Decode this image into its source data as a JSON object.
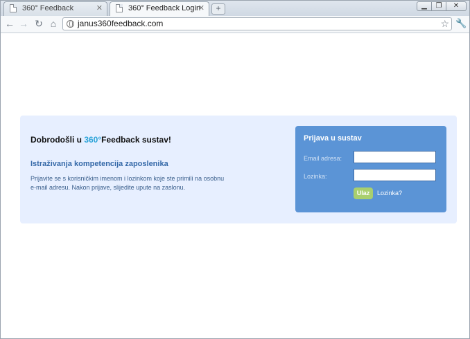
{
  "browser": {
    "tabs": [
      {
        "label": "360° Feedback",
        "active": false
      },
      {
        "label": "360° Feedback Login",
        "active": true
      }
    ],
    "new_tab_symbol": "+",
    "url": "janus360feedback.com",
    "icons": {
      "back": "back-arrow-icon",
      "forward": "forward-arrow-icon",
      "reload": "reload-icon",
      "home": "home-icon",
      "site": "globe-icon",
      "bookmark": "star-icon",
      "menu": "wrench-icon"
    }
  },
  "welcome": {
    "title_prefix": "Dobrodošli u ",
    "brand": "360°",
    "title_suffix": "Feedback sustav!",
    "subheading": "Istraživanja kompetencija zaposlenika",
    "intro_line1": "Prijavite se s korisničkim imenom i lozinkom koje ste primili na osobnu",
    "intro_line2": "e-mail adresu. Nakon prijave, slijedite upute na zaslonu."
  },
  "login": {
    "title": "Prijava u sustav",
    "email_label": "Email adresa:",
    "email_value": "",
    "password_label": "Lozinka:",
    "password_value": "",
    "submit_label": "Ulaz",
    "forgot_label": "Lozinka?"
  },
  "colors": {
    "panel_background": "#e7efff",
    "login_box": "#5b94d6",
    "brand": "#2aa3d8",
    "subheading": "#3569a8",
    "submit_button": "#a9cf6e"
  }
}
